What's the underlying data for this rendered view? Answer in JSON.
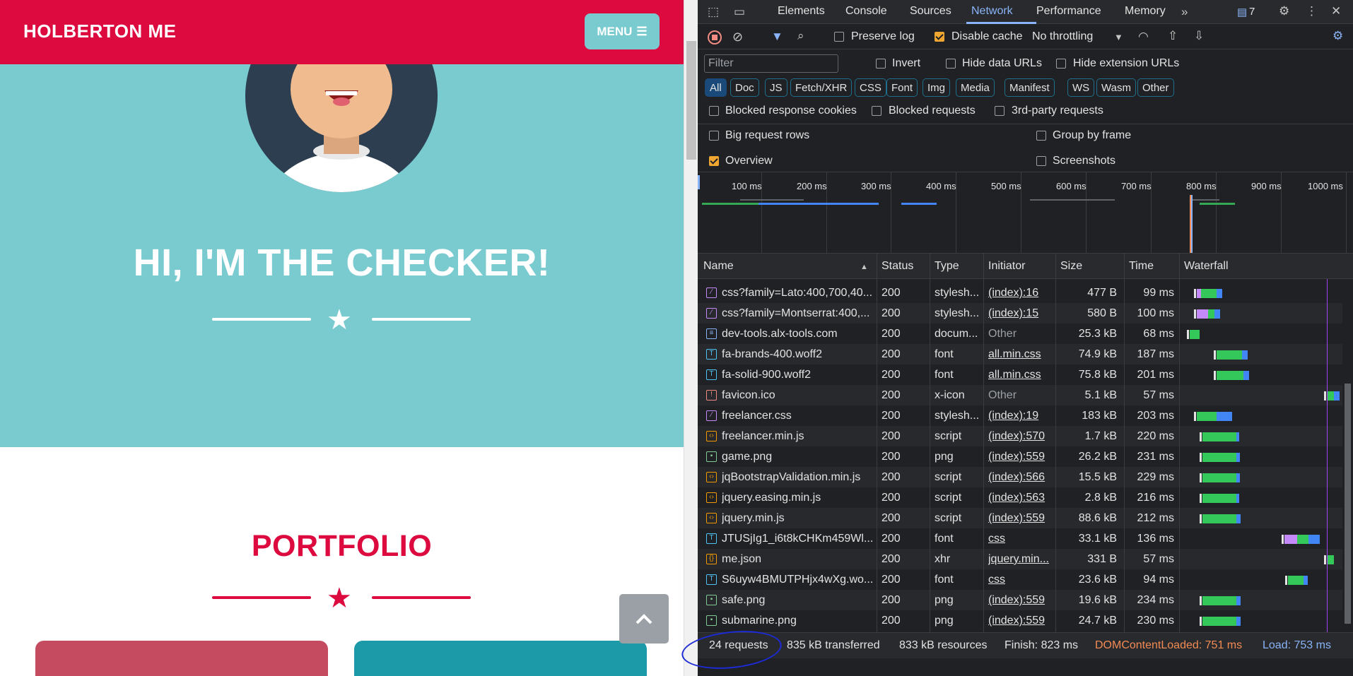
{
  "site": {
    "brand": "HOLBERTON ME",
    "menu_label": "MENU",
    "hero_title": "HI, I'M THE CHECKER!",
    "portfolio_title": "PORTFOLIO"
  },
  "devtools": {
    "tabs": [
      "Elements",
      "Console",
      "Sources",
      "Network",
      "Performance",
      "Memory"
    ],
    "active_tab": "Network",
    "messages_count": "7",
    "toolbar": {
      "preserve_log": "Preserve log",
      "disable_cache": "Disable cache",
      "throttling": "No throttling"
    },
    "filter_placeholder": "Filter",
    "invert": "Invert",
    "hide_data_urls": "Hide data URLs",
    "hide_extension_urls": "Hide extension URLs",
    "type_filters": [
      "All",
      "Doc",
      "JS",
      "Fetch/XHR",
      "CSS",
      "Font",
      "Img",
      "Media",
      "Manifest",
      "WS",
      "Wasm",
      "Other"
    ],
    "blocked_response_cookies": "Blocked response cookies",
    "blocked_requests": "Blocked requests",
    "third_party": "3rd-party requests",
    "big_request_rows": "Big request rows",
    "group_by_frame": "Group by frame",
    "overview": "Overview",
    "screenshots": "Screenshots",
    "overview_ticks": [
      "100 ms",
      "200 ms",
      "300 ms",
      "400 ms",
      "500 ms",
      "600 ms",
      "700 ms",
      "800 ms",
      "900 ms",
      "1000 ms"
    ],
    "columns": [
      "Name",
      "Status",
      "Type",
      "Initiator",
      "Size",
      "Time",
      "Waterfall"
    ],
    "requests": [
      {
        "name": "css?family=Lato:400,700,40...",
        "status": "200",
        "type": "stylesh...",
        "initiator": "(index):16",
        "size": "477 B",
        "time": "99 ms",
        "icon": "css"
      },
      {
        "name": "css?family=Montserrat:400,...",
        "status": "200",
        "type": "stylesh...",
        "initiator": "(index):15",
        "size": "580 B",
        "time": "100 ms",
        "icon": "css"
      },
      {
        "name": "dev-tools.alx-tools.com",
        "status": "200",
        "type": "docum...",
        "initiator": "Other",
        "size": "25.3 kB",
        "time": "68 ms",
        "icon": "doc"
      },
      {
        "name": "fa-brands-400.woff2",
        "status": "200",
        "type": "font",
        "initiator": "all.min.css",
        "size": "74.9 kB",
        "time": "187 ms",
        "icon": "font"
      },
      {
        "name": "fa-solid-900.woff2",
        "status": "200",
        "type": "font",
        "initiator": "all.min.css",
        "size": "75.8 kB",
        "time": "201 ms",
        "icon": "font"
      },
      {
        "name": "favicon.ico",
        "status": "200",
        "type": "x-icon",
        "initiator": "Other",
        "size": "5.1 kB",
        "time": "57 ms",
        "icon": "ico"
      },
      {
        "name": "freelancer.css",
        "status": "200",
        "type": "stylesh...",
        "initiator": "(index):19",
        "size": "183 kB",
        "time": "203 ms",
        "icon": "css"
      },
      {
        "name": "freelancer.min.js",
        "status": "200",
        "type": "script",
        "initiator": "(index):570",
        "size": "1.7 kB",
        "time": "220 ms",
        "icon": "js"
      },
      {
        "name": "game.png",
        "status": "200",
        "type": "png",
        "initiator": "(index):559",
        "size": "26.2 kB",
        "time": "231 ms",
        "icon": "img"
      },
      {
        "name": "jqBootstrapValidation.min.js",
        "status": "200",
        "type": "script",
        "initiator": "(index):566",
        "size": "15.5 kB",
        "time": "229 ms",
        "icon": "js"
      },
      {
        "name": "jquery.easing.min.js",
        "status": "200",
        "type": "script",
        "initiator": "(index):563",
        "size": "2.8 kB",
        "time": "216 ms",
        "icon": "js"
      },
      {
        "name": "jquery.min.js",
        "status": "200",
        "type": "script",
        "initiator": "(index):559",
        "size": "88.6 kB",
        "time": "212 ms",
        "icon": "js"
      },
      {
        "name": "JTUSjIg1_i6t8kCHKm459Wl...",
        "status": "200",
        "type": "font",
        "initiator": "css",
        "size": "33.1 kB",
        "time": "136 ms",
        "icon": "font"
      },
      {
        "name": "me.json",
        "status": "200",
        "type": "xhr",
        "initiator": "jquery.min...",
        "size": "331 B",
        "time": "57 ms",
        "icon": "xhr"
      },
      {
        "name": "S6uyw4BMUTPHjx4wXg.wo...",
        "status": "200",
        "type": "font",
        "initiator": "css",
        "size": "23.6 kB",
        "time": "94 ms",
        "icon": "font"
      },
      {
        "name": "safe.png",
        "status": "200",
        "type": "png",
        "initiator": "(index):559",
        "size": "19.6 kB",
        "time": "234 ms",
        "icon": "img"
      },
      {
        "name": "submarine.png",
        "status": "200",
        "type": "png",
        "initiator": "(index):559",
        "size": "24.7 kB",
        "time": "230 ms",
        "icon": "img"
      }
    ],
    "summary": {
      "requests": "24 requests",
      "transferred": "835 kB transferred",
      "resources": "833 kB resources",
      "finish": "Finish: 823 ms",
      "dom_content_loaded": "DOMContentLoaded: 751 ms",
      "load": "Load: 753 ms"
    }
  },
  "colors": {
    "brand_red": "#dc0a3f",
    "teal": "#79cbd0",
    "dcl_orange": "#f28b54",
    "load_blue": "#8ab4f8"
  }
}
